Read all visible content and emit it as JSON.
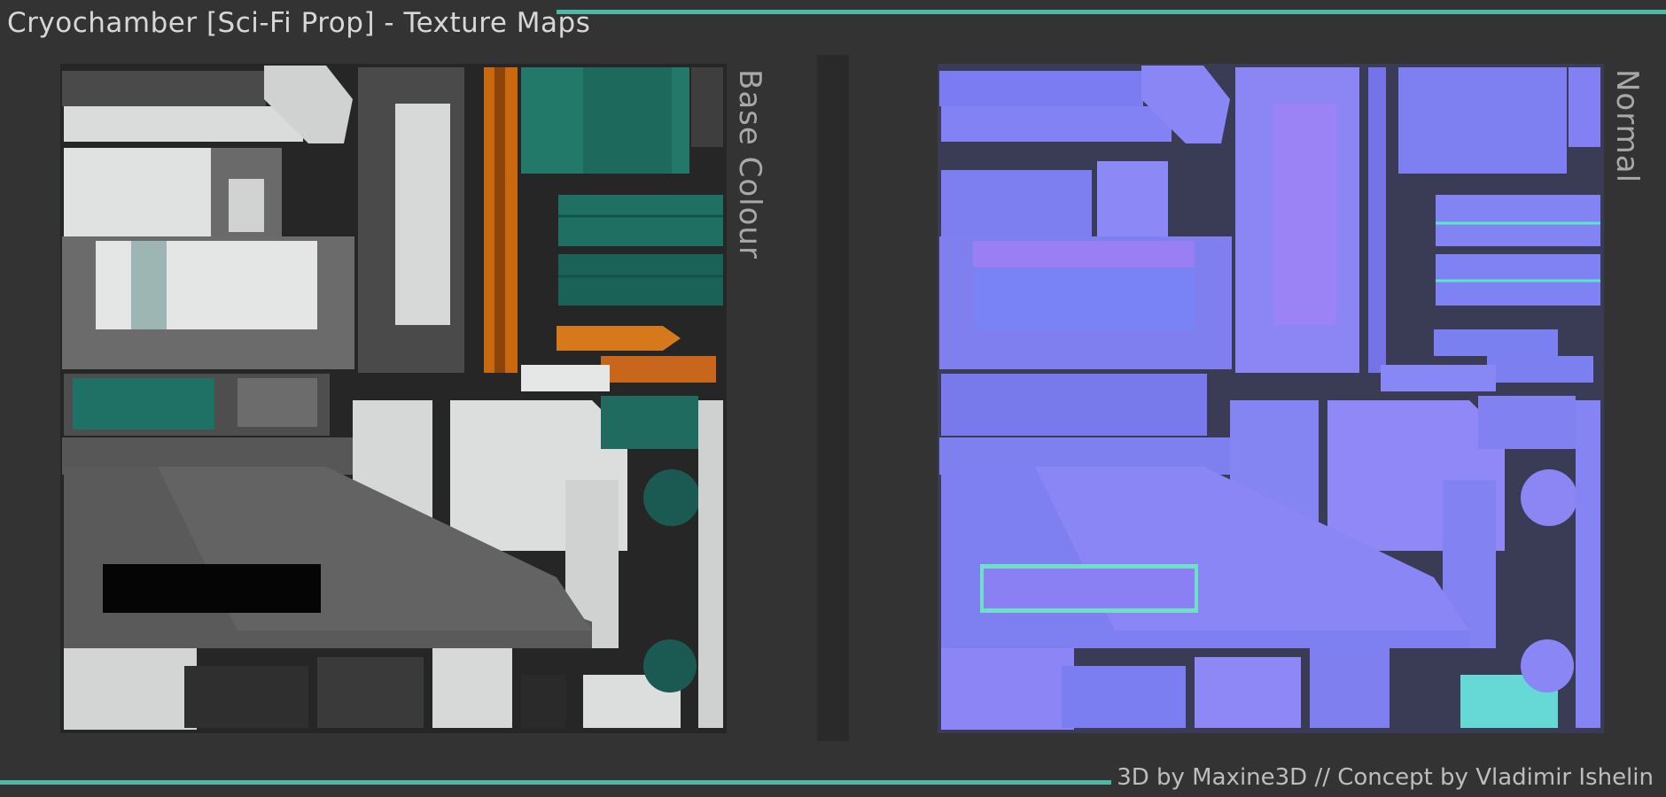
{
  "header": {
    "title": "Cryochamber [Sci-Fi Prop] - Texture Maps"
  },
  "panels": {
    "base": {
      "label": "Base Colour"
    },
    "normal": {
      "label": "Normal"
    }
  },
  "footer": {
    "credits": "3D by Maxine3D // Concept by Vladimir Ishelin"
  },
  "colors": {
    "accent": "#4fb8a5",
    "background": "#2a2a2a",
    "panel": "#333333",
    "normal_base": "#7f7ff0",
    "base_grey": "#5a5a5a",
    "base_white": "#dfe2e1",
    "base_teal": "#1f6f63",
    "base_orange": "#c9680f"
  }
}
